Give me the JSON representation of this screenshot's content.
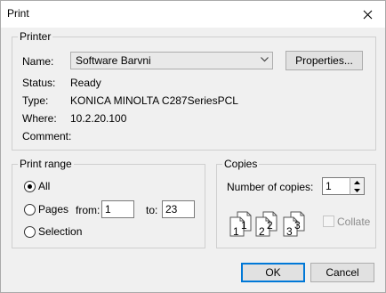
{
  "window": {
    "title": "Print"
  },
  "printer": {
    "group_label": "Printer",
    "name_label": "Name:",
    "name_value": "Software Barvni",
    "properties_label": "Properties...",
    "status_label": "Status:",
    "status_value": "Ready",
    "type_label": "Type:",
    "type_value": "KONICA MINOLTA C287SeriesPCL",
    "where_label": "Where:",
    "where_value": "10.2.20.100",
    "comment_label": "Comment:",
    "comment_value": ""
  },
  "print_range": {
    "group_label": "Print range",
    "all_label": "All",
    "pages_label": "Pages",
    "from_label": "from:",
    "from_value": "1",
    "to_label": "to:",
    "to_value": "23",
    "selection_label": "Selection",
    "selected": "All"
  },
  "copies": {
    "group_label": "Copies",
    "number_label": "Number of copies:",
    "number_value": "1",
    "collate_label": "Collate",
    "collate_checked": false,
    "collate_pages": [
      "1",
      "2",
      "3"
    ]
  },
  "buttons": {
    "ok": "OK",
    "cancel": "Cancel"
  },
  "colors": {
    "accent": "#0078d7",
    "dialog_bg": "#f0f0f0",
    "disabled_text": "#8c8c8c"
  },
  "icons": {
    "close": "close-icon",
    "dropdown": "chevron-down-icon",
    "spin_up": "arrow-up-icon",
    "spin_down": "arrow-down-icon"
  }
}
